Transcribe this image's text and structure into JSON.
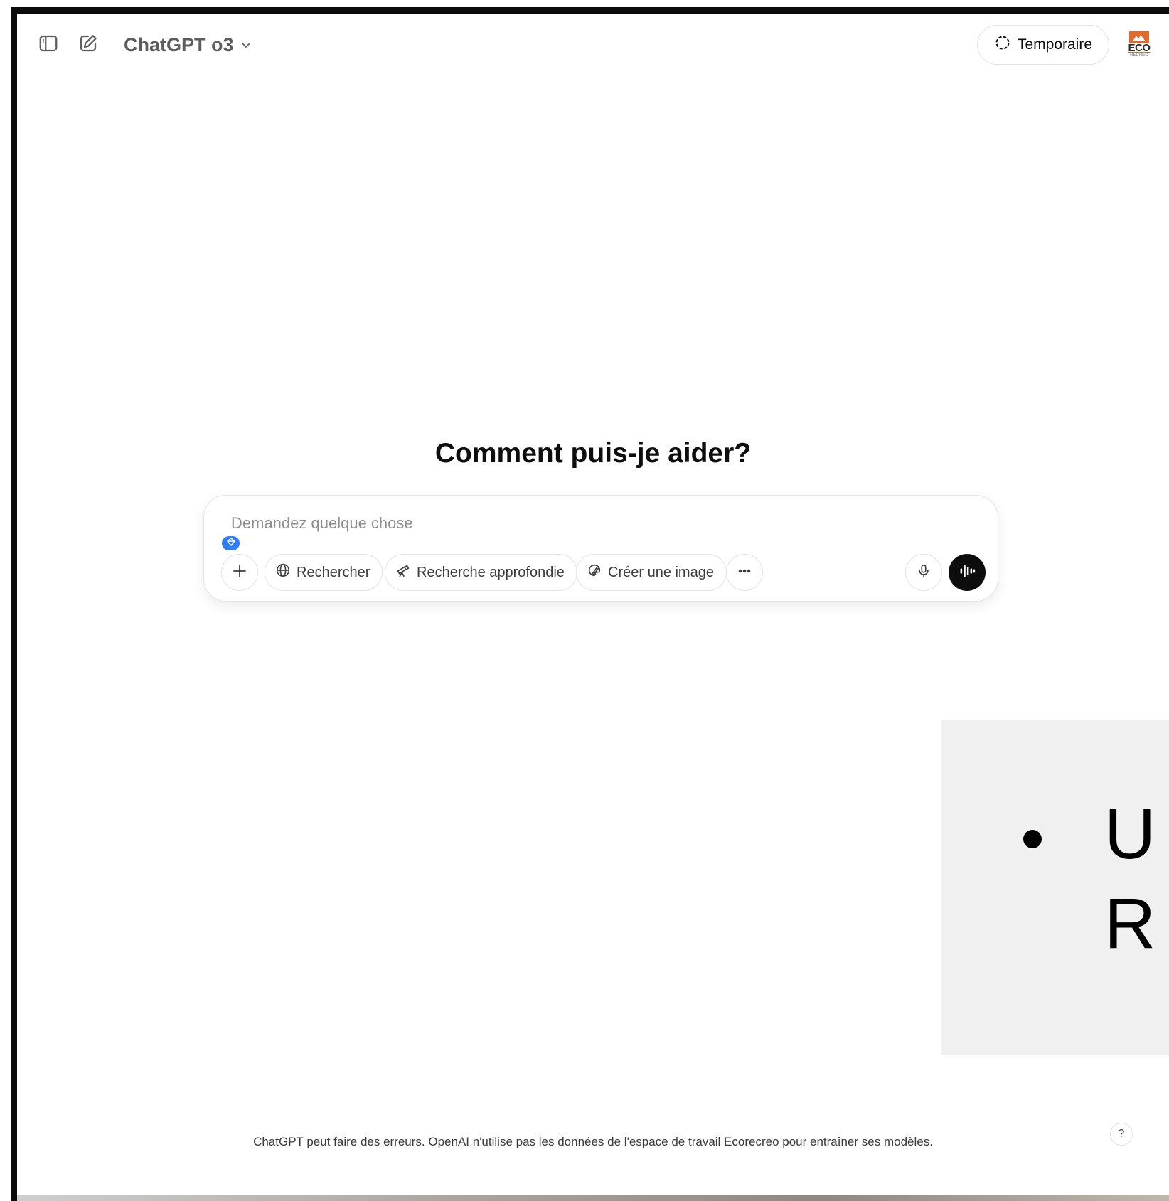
{
  "header": {
    "model_name": "ChatGPT o3",
    "temporary_label": "Temporaire",
    "avatar_text": "ECO",
    "avatar_subtext": "RÉCRÉO"
  },
  "main": {
    "headline": "Comment puis-je aider?"
  },
  "composer": {
    "placeholder": "Demandez quelque chose",
    "buttons": {
      "search": "Rechercher",
      "deep_research": "Recherche approfondie",
      "create_image": "Créer une image"
    }
  },
  "overlay": {
    "line1": "U",
    "line2": "R"
  },
  "footer": {
    "note": "ChatGPT peut faire des erreurs. OpenAI n'utilise pas les données de l'espace de travail Ecorecreo pour entraîner ses modèles.",
    "help": "?"
  },
  "icons": {
    "sidebar_toggle": "sidebar-toggle-icon",
    "new_chat": "new-chat-icon",
    "chevron": "chevron-down-icon",
    "temporary": "temporary-chat-icon",
    "plus": "plus-icon",
    "globe": "globe-icon",
    "telescope": "telescope-icon",
    "image": "image-create-icon",
    "more": "more-icon",
    "microphone": "microphone-icon",
    "voice": "voice-mode-icon"
  },
  "colors": {
    "voice_button": "#0d0d0d",
    "extension_badge": "#2f7df6",
    "brand_orange": "#e1692b"
  }
}
